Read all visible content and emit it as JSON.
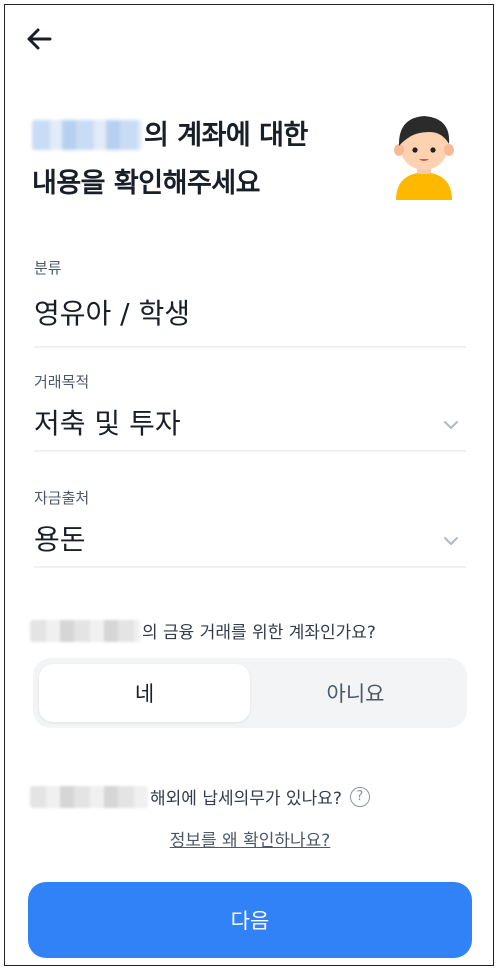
{
  "header": {
    "back_icon": "arrow-left-icon",
    "title_line1_suffix": "의 계좌에 대한",
    "title_line2": "내용을 확인해주세요",
    "avatar_icon": "child-avatar-icon"
  },
  "fields": [
    {
      "label": "분류",
      "value": "영유아 / 학생",
      "has_dropdown": false
    },
    {
      "label": "거래목적",
      "value": "저축 및 투자",
      "has_dropdown": true
    },
    {
      "label": "자금출처",
      "value": "용돈",
      "has_dropdown": true
    }
  ],
  "question_foreign_tax": {
    "text": "해외에 납세의무가 있나요?",
    "help_icon": "question-circle-icon",
    "help_glyph": "?"
  },
  "question_financial": {
    "text": "의 금융 거래를 위한 계좌인가요?",
    "options": [
      "네",
      "아니요"
    ],
    "selected": "네"
  },
  "why_link": "정보를 왜 확인하나요?",
  "next_button": "다음",
  "colors": {
    "primary": "#3182f6",
    "segment_bg": "#f2f4f6",
    "text_dark": "#191f28",
    "text_gray": "#4e5968"
  }
}
